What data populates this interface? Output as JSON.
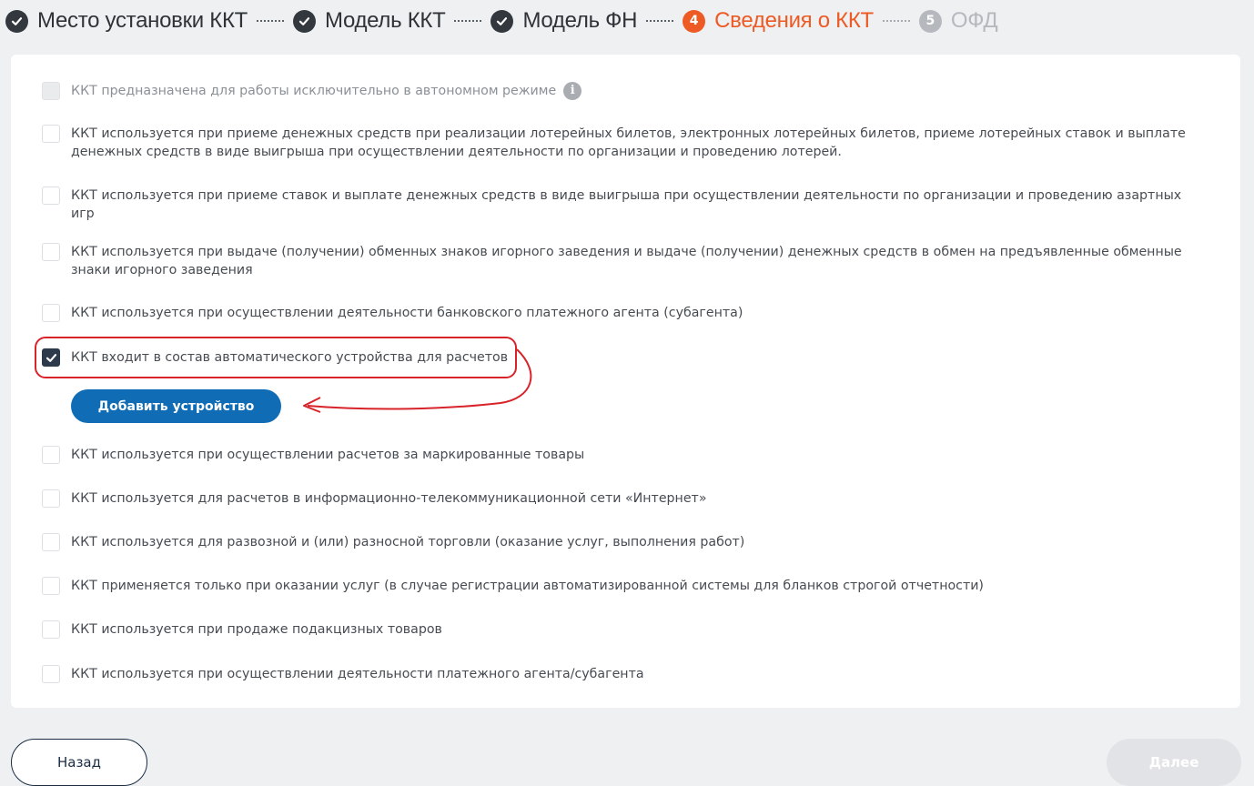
{
  "stepper": {
    "steps": [
      {
        "label": "Место установки ККТ",
        "state": "done",
        "icon": "check-icon"
      },
      {
        "label": "Модель ККТ",
        "state": "done",
        "icon": "check-icon"
      },
      {
        "label": "Модель ФН",
        "state": "done",
        "icon": "check-icon"
      },
      {
        "label": "Сведения о ККТ",
        "state": "current",
        "number": "4"
      },
      {
        "label": "ОФД",
        "state": "future",
        "number": "5"
      }
    ]
  },
  "options": [
    {
      "text": "ККТ предназначена для работы исключительно в автономном режиме",
      "checked": false,
      "disabled": true,
      "info": true
    },
    {
      "text": "ККТ используется при приеме денежных средств при реализации лотерейных билетов, электронных лотерейных билетов, приеме лотерейных ставок и выплате денежных средств в виде выигрыша при осуществлении деятельности по организации и проведению лотерей.",
      "checked": false
    },
    {
      "text": "ККТ используется при приеме ставок и выплате денежных средств в виде выигрыша при осуществлении деятельности по организации и проведению азартных игр",
      "checked": false
    },
    {
      "text": "ККТ используется при выдаче (получении) обменных знаков игорного заведения и выдаче (получении) денежных средств в обмен на предъявленные обменные знаки игорного заведения",
      "checked": false
    },
    {
      "text": "ККТ используется при осуществлении деятельности банковского платежного агента (субагента)",
      "checked": false
    },
    {
      "text": "ККТ входит в состав автоматического устройства для расчетов",
      "checked": true
    },
    {
      "text": "ККТ используется при осуществлении расчетов за маркированные товары",
      "checked": false
    },
    {
      "text": "ККТ используется для расчетов в информационно-телекоммуникационной сети «Интернет»",
      "checked": false
    },
    {
      "text": "ККТ используется для развозной и (или) разносной торговли (оказание услуг, выполнения работ)",
      "checked": false
    },
    {
      "text": "ККТ применяется только при оказании услуг (в случае регистрации автоматизированной системы для бланков строгой отчетности)",
      "checked": false
    },
    {
      "text": "ККТ используется при продаже подакцизных товаров",
      "checked": false
    },
    {
      "text": "ККТ используется при осуществлении деятельности платежного агента/субагента",
      "checked": false
    }
  ],
  "add_device_label": "Добавить устройство",
  "nav": {
    "back_label": "Назад",
    "next_label": "Далее"
  },
  "colors": {
    "accent": "#ed5a24",
    "primary": "#0f6cb5",
    "annotation": "#d8232a"
  }
}
